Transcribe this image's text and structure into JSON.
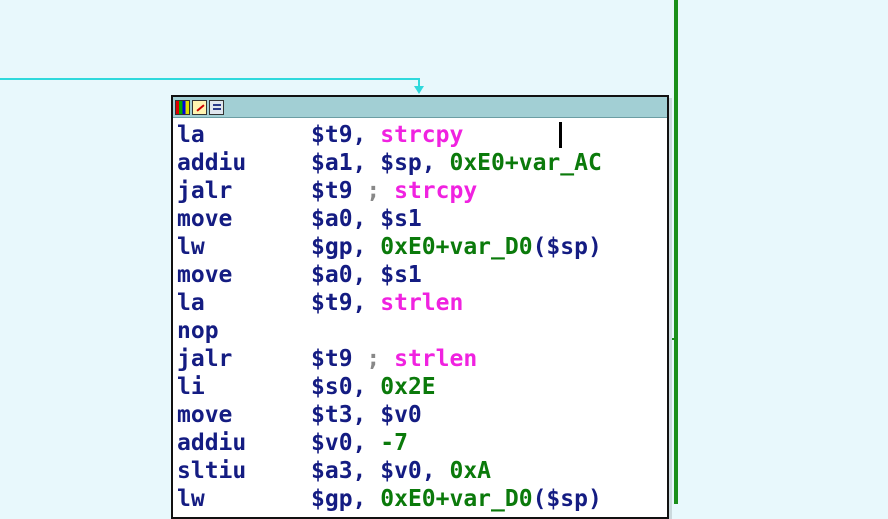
{
  "colors": {
    "background": "#e8f8fc",
    "edge": "#2fd9dc",
    "right_edge": "#1a8f1a",
    "node_header": "#a2cfd4",
    "mnemonic": "#141c82",
    "number": "#0b7a0b",
    "symbol": "#f022e0",
    "comment": "#888888"
  },
  "node": {
    "header_icons": [
      "graph-colors-icon",
      "edit-node-icon",
      "node-list-icon"
    ],
    "lines": [
      {
        "mnemonic": "la",
        "parts": [
          {
            "t": "$t9, ",
            "c": "ops"
          },
          {
            "t": "strcpy",
            "c": "sym"
          }
        ]
      },
      {
        "mnemonic": "addiu",
        "parts": [
          {
            "t": "$a1, $sp, ",
            "c": "ops"
          },
          {
            "t": "0xE0+var_AC",
            "c": "num"
          }
        ]
      },
      {
        "mnemonic": "jalr",
        "parts": [
          {
            "t": "$t9 ",
            "c": "ops"
          },
          {
            "t": "; ",
            "c": "cm"
          },
          {
            "t": "strcpy",
            "c": "sym"
          }
        ]
      },
      {
        "mnemonic": "move",
        "parts": [
          {
            "t": "$a0, $s1",
            "c": "ops"
          }
        ]
      },
      {
        "mnemonic": "lw",
        "parts": [
          {
            "t": "$gp, ",
            "c": "ops"
          },
          {
            "t": "0xE0+var_D0",
            "c": "num"
          },
          {
            "t": "($sp)",
            "c": "ops"
          }
        ]
      },
      {
        "mnemonic": "move",
        "parts": [
          {
            "t": "$a0, $s1",
            "c": "ops"
          }
        ]
      },
      {
        "mnemonic": "la",
        "parts": [
          {
            "t": "$t9, ",
            "c": "ops"
          },
          {
            "t": "strlen",
            "c": "sym"
          }
        ]
      },
      {
        "mnemonic": "nop",
        "parts": []
      },
      {
        "mnemonic": "jalr",
        "parts": [
          {
            "t": "$t9 ",
            "c": "ops"
          },
          {
            "t": "; ",
            "c": "cm"
          },
          {
            "t": "strlen",
            "c": "sym"
          }
        ]
      },
      {
        "mnemonic": "li",
        "parts": [
          {
            "t": "$s0, ",
            "c": "ops"
          },
          {
            "t": "0x2E",
            "c": "num"
          }
        ]
      },
      {
        "mnemonic": "move",
        "parts": [
          {
            "t": "$t3, $v0",
            "c": "ops"
          }
        ]
      },
      {
        "mnemonic": "addiu",
        "parts": [
          {
            "t": "$v0, ",
            "c": "ops"
          },
          {
            "t": "-7",
            "c": "num"
          }
        ]
      },
      {
        "mnemonic": "sltiu",
        "parts": [
          {
            "t": "$a3, $v0, ",
            "c": "ops"
          },
          {
            "t": "0xA",
            "c": "num"
          }
        ]
      },
      {
        "mnemonic": "lw",
        "parts": [
          {
            "t": "$gp, ",
            "c": "ops"
          },
          {
            "t": "0xE0+var_D0",
            "c": "num"
          },
          {
            "t": "($sp)",
            "c": "ops"
          }
        ]
      }
    ]
  }
}
